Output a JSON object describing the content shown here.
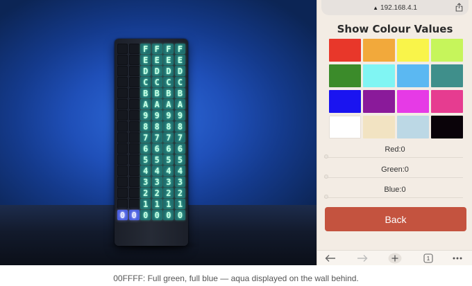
{
  "photo": {
    "device_rows": [
      [
        "",
        "",
        "F",
        "F",
        "F",
        "F"
      ],
      [
        "",
        "",
        "E",
        "E",
        "E",
        "E"
      ],
      [
        "",
        "",
        "D",
        "D",
        "D",
        "D"
      ],
      [
        "",
        "",
        "C",
        "C",
        "C",
        "C"
      ],
      [
        "",
        "",
        "B",
        "B",
        "B",
        "B"
      ],
      [
        "",
        "",
        "A",
        "A",
        "A",
        "A"
      ],
      [
        "",
        "",
        "9",
        "9",
        "9",
        "9"
      ],
      [
        "",
        "",
        "8",
        "8",
        "8",
        "8"
      ],
      [
        "",
        "",
        "7",
        "7",
        "7",
        "7"
      ],
      [
        "",
        "",
        "6",
        "6",
        "6",
        "6"
      ],
      [
        "",
        "",
        "5",
        "5",
        "5",
        "5"
      ],
      [
        "",
        "",
        "4",
        "4",
        "4",
        "4"
      ],
      [
        "",
        "",
        "3",
        "3",
        "3",
        "3"
      ],
      [
        "",
        "",
        "2",
        "2",
        "2",
        "2"
      ],
      [
        "",
        "",
        "1",
        "1",
        "1",
        "1"
      ],
      [
        "0",
        "0",
        "0",
        "0",
        "0",
        "0"
      ]
    ],
    "display_colors": {
      "green": "#7fffd0",
      "blue": "#9aa6ff",
      "off": "#15181f"
    }
  },
  "browser": {
    "url": "192.168.4.1",
    "lock_icon": "lock-icon",
    "share_icon": "share-icon"
  },
  "page": {
    "title": "Show Colour Values",
    "swatches": [
      "#e8372a",
      "#f2a93b",
      "#f9f44a",
      "#c6f55b",
      "#3b8b2a",
      "#80f5f3",
      "#5bb8f2",
      "#3f8f8b",
      "#1a14f0",
      "#8a1a9a",
      "#e63ae6",
      "#e63c90",
      "#ffffff",
      "#f2e3c2",
      "#bcd8e5",
      "#0a0309"
    ],
    "sliders": [
      {
        "label": "Red:0",
        "value": 0
      },
      {
        "label": "Green:0",
        "value": 0
      },
      {
        "label": "Blue:0",
        "value": 0
      }
    ],
    "back_label": "Back",
    "back_color": "#c4533f"
  },
  "toolbar": {
    "back_icon": "arrow-left-icon",
    "forward_icon": "arrow-right-icon",
    "new_tab_icon": "plus-icon",
    "tab_count": "1",
    "more_icon": "more-dots-icon"
  },
  "caption": "00FFFF: Full green, full blue — aqua displayed on the wall behind."
}
